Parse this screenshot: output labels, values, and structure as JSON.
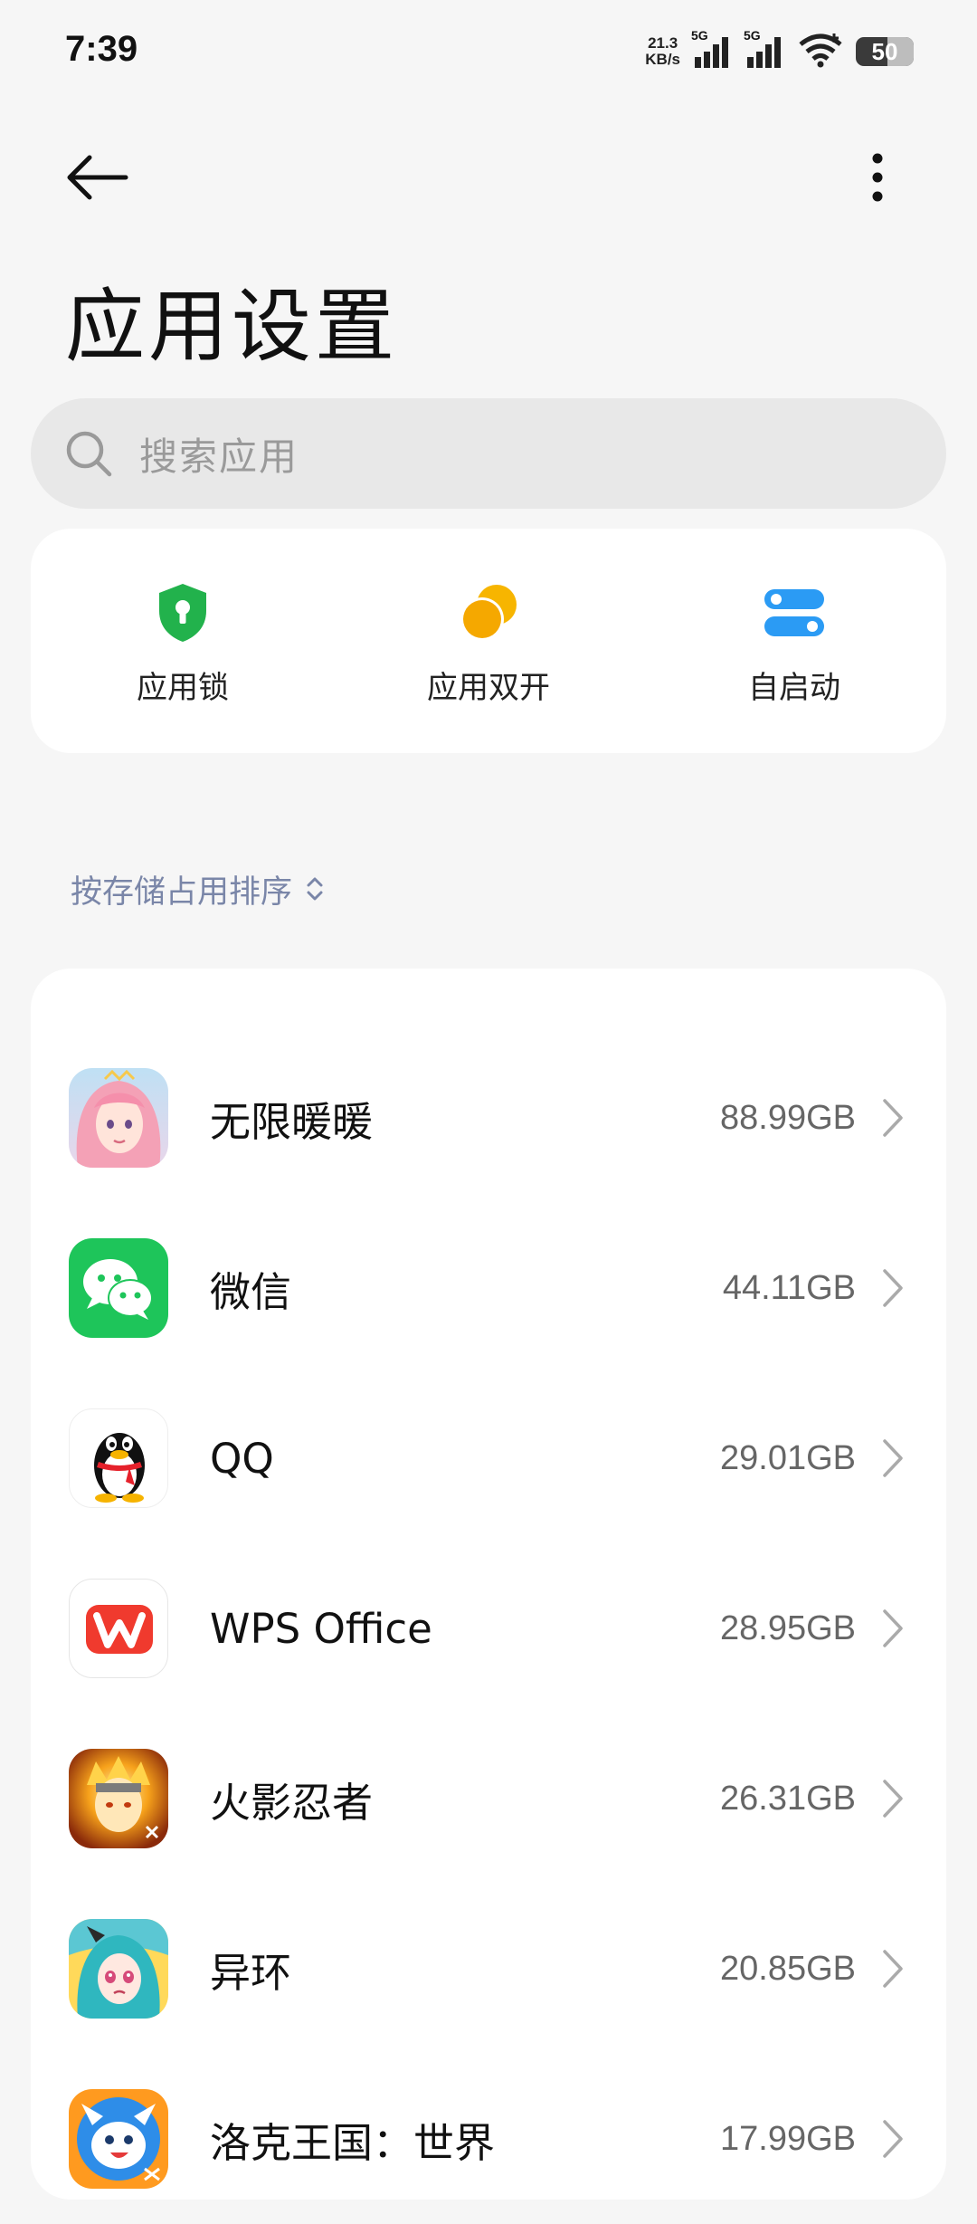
{
  "status_bar": {
    "time": "7:39",
    "net_speed_value": "21.3",
    "net_speed_unit": "KB/s",
    "sim1_label": "5G",
    "sim2_label": "5G",
    "battery": "50"
  },
  "header": {
    "title": "应用设置"
  },
  "search": {
    "placeholder": "搜索应用"
  },
  "shortcuts": [
    {
      "label": "应用锁",
      "icon": "shield-lock-icon",
      "color": "#22b24c"
    },
    {
      "label": "应用双开",
      "icon": "dual-circles-icon",
      "color": "#f5b500"
    },
    {
      "label": "自启动",
      "icon": "toggles-icon",
      "color": "#2b9bf4"
    }
  ],
  "sort": {
    "label": "按存储占用排序"
  },
  "apps": [
    {
      "name": "无限暖暖",
      "size": "88.99GB",
      "icon": "infinity-nikki-icon"
    },
    {
      "name": "微信",
      "size": "44.11GB",
      "icon": "wechat-icon"
    },
    {
      "name": "QQ",
      "size": "29.01GB",
      "icon": "qq-penguin-icon"
    },
    {
      "name": "WPS Office",
      "size": "28.95GB",
      "icon": "wps-icon"
    },
    {
      "name": "火影忍者",
      "size": "26.31GB",
      "icon": "naruto-icon"
    },
    {
      "name": "异环",
      "size": "20.85GB",
      "icon": "yihuan-icon"
    },
    {
      "name": "洛克王国：世界",
      "size": "17.99GB",
      "icon": "roco-kingdom-icon"
    }
  ]
}
